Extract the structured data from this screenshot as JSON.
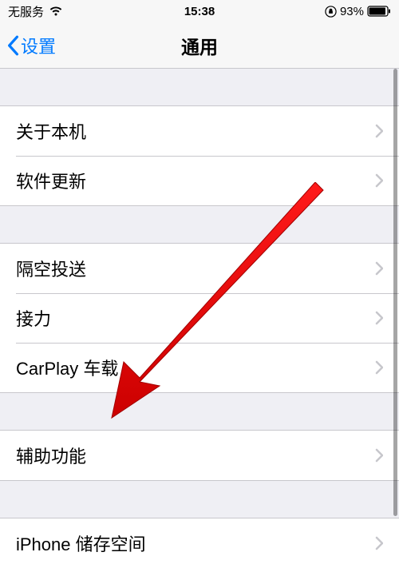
{
  "status": {
    "carrier": "无服务",
    "time": "15:38",
    "battery_pct": "93%"
  },
  "nav": {
    "back_label": "设置",
    "title": "通用"
  },
  "groups": [
    {
      "items": [
        {
          "key": "about",
          "label": "关于本机"
        },
        {
          "key": "software-update",
          "label": "软件更新"
        }
      ]
    },
    {
      "items": [
        {
          "key": "airdrop",
          "label": "隔空投送"
        },
        {
          "key": "handoff",
          "label": "接力"
        },
        {
          "key": "carplay",
          "label": "CarPlay 车载"
        }
      ]
    },
    {
      "items": [
        {
          "key": "accessibility",
          "label": "辅助功能"
        }
      ]
    },
    {
      "items": [
        {
          "key": "iphone-storage",
          "label": "iPhone 储存空间"
        }
      ]
    }
  ]
}
